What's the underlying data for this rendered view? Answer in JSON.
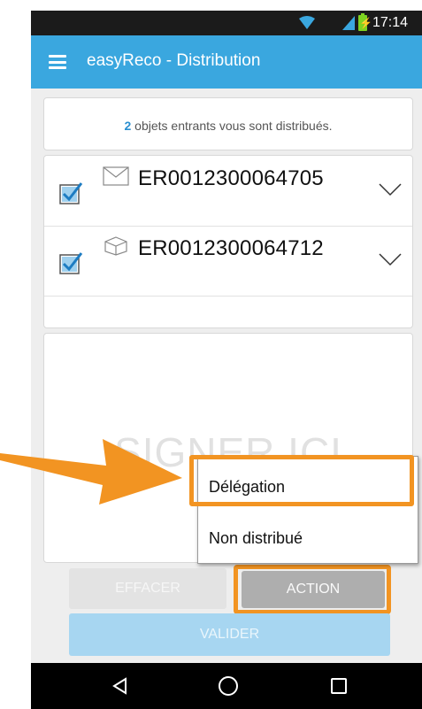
{
  "status_bar": {
    "time": "17:14",
    "icons": [
      "wifi-icon",
      "signal-icon",
      "battery-charging-icon"
    ],
    "battery_color": "#7ed321"
  },
  "app_bar": {
    "title": "easyReco - Distribution",
    "color": "#3aa7df",
    "menu_icon": "hamburger-menu-icon"
  },
  "info": {
    "count": "2",
    "message": "objets entrants vous sont distribués."
  },
  "items": [
    {
      "checked": true,
      "type_icon": "envelope-icon",
      "tracking": "ER0012300064705"
    },
    {
      "checked": true,
      "type_icon": "package-icon",
      "tracking": "ER0012300064712"
    }
  ],
  "signature": {
    "placeholder": "SIGNER ICI"
  },
  "buttons": {
    "effacer": "EFFACER",
    "action": "ACTION",
    "valider": "VALIDER"
  },
  "action_menu": {
    "options": [
      "Délégation",
      "Non distribué"
    ]
  },
  "annotation": {
    "highlight_color": "#f29422"
  },
  "nav_bar": {
    "icons": [
      "back-icon",
      "home-icon",
      "recent-apps-icon"
    ]
  }
}
